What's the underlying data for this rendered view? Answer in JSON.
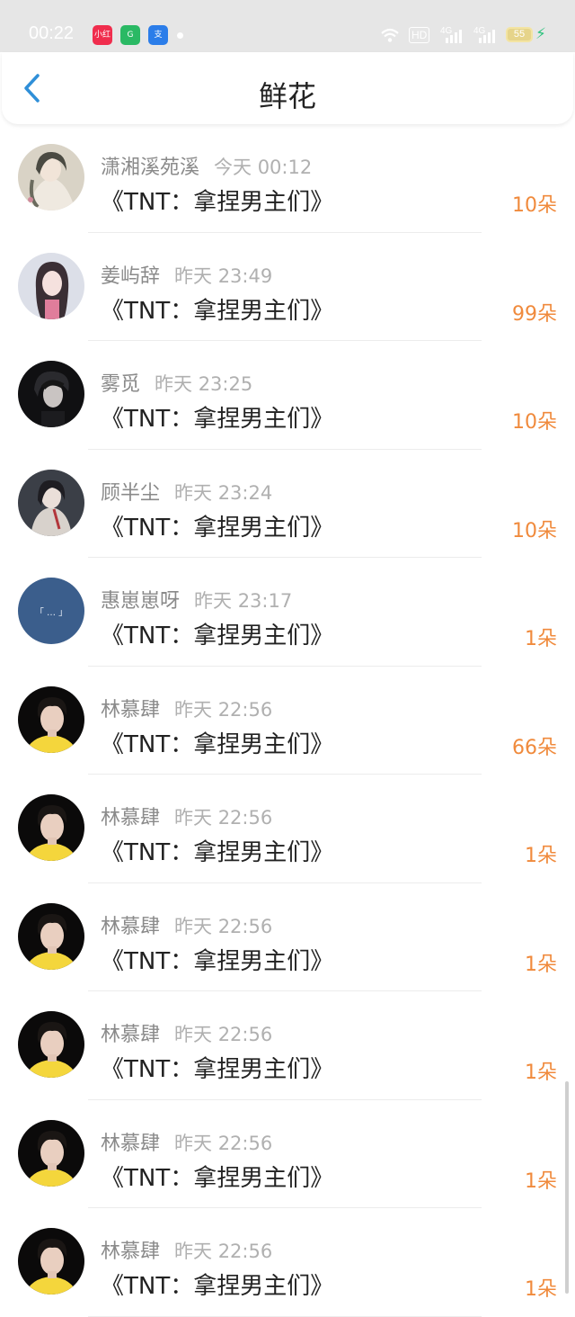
{
  "status": {
    "time": "00:22",
    "hd": "HD",
    "network1": "4G",
    "network2": "4G",
    "battery": "55"
  },
  "status_apps": [
    {
      "name": "xiaohongshu-app-icon",
      "label": "小红书",
      "bg": "#f02d4d"
    },
    {
      "name": "green-app-icon",
      "label": "G",
      "bg": "#2ab964"
    },
    {
      "name": "blue-app-icon",
      "label": "支",
      "bg": "#2b7de9"
    }
  ],
  "header": {
    "title": "鲜花"
  },
  "colors": {
    "count": "#f08a3c",
    "back": "#2f8fd8"
  },
  "items": [
    {
      "name": "潇湘溪苑溪",
      "time": "今天 00:12",
      "book": "《TNT：拿捏男主们》",
      "count": "10朵",
      "avatar": "art-girl"
    },
    {
      "name": "姜屿辞",
      "time": "昨天 23:49",
      "book": "《TNT：拿捏男主们》",
      "count": "99朵",
      "avatar": "pink-girl"
    },
    {
      "name": "雾觅",
      "time": "昨天 23:25",
      "book": "《TNT：拿捏男主们》",
      "count": "10朵",
      "avatar": "dark-boy"
    },
    {
      "name": "顾半尘",
      "time": "昨天 23:24",
      "book": "《TNT：拿捏男主们》",
      "count": "10朵",
      "avatar": "painted-girl"
    },
    {
      "name": "惠崽崽呀",
      "time": "昨天 23:17",
      "book": "《TNT：拿捏男主们》",
      "count": "1朵",
      "avatar": "blue-text"
    },
    {
      "name": "林慕肆",
      "time": "昨天 22:56",
      "book": "《TNT：拿捏男主们》",
      "count": "66朵",
      "avatar": "yellow-boy"
    },
    {
      "name": "林慕肆",
      "time": "昨天 22:56",
      "book": "《TNT：拿捏男主们》",
      "count": "1朵",
      "avatar": "yellow-boy"
    },
    {
      "name": "林慕肆",
      "time": "昨天 22:56",
      "book": "《TNT：拿捏男主们》",
      "count": "1朵",
      "avatar": "yellow-boy"
    },
    {
      "name": "林慕肆",
      "time": "昨天 22:56",
      "book": "《TNT：拿捏男主们》",
      "count": "1朵",
      "avatar": "yellow-boy"
    },
    {
      "name": "林慕肆",
      "time": "昨天 22:56",
      "book": "《TNT：拿捏男主们》",
      "count": "1朵",
      "avatar": "yellow-boy"
    },
    {
      "name": "林慕肆",
      "time": "昨天 22:56",
      "book": "《TNT：拿捏男主们》",
      "count": "1朵",
      "avatar": "yellow-boy"
    }
  ]
}
